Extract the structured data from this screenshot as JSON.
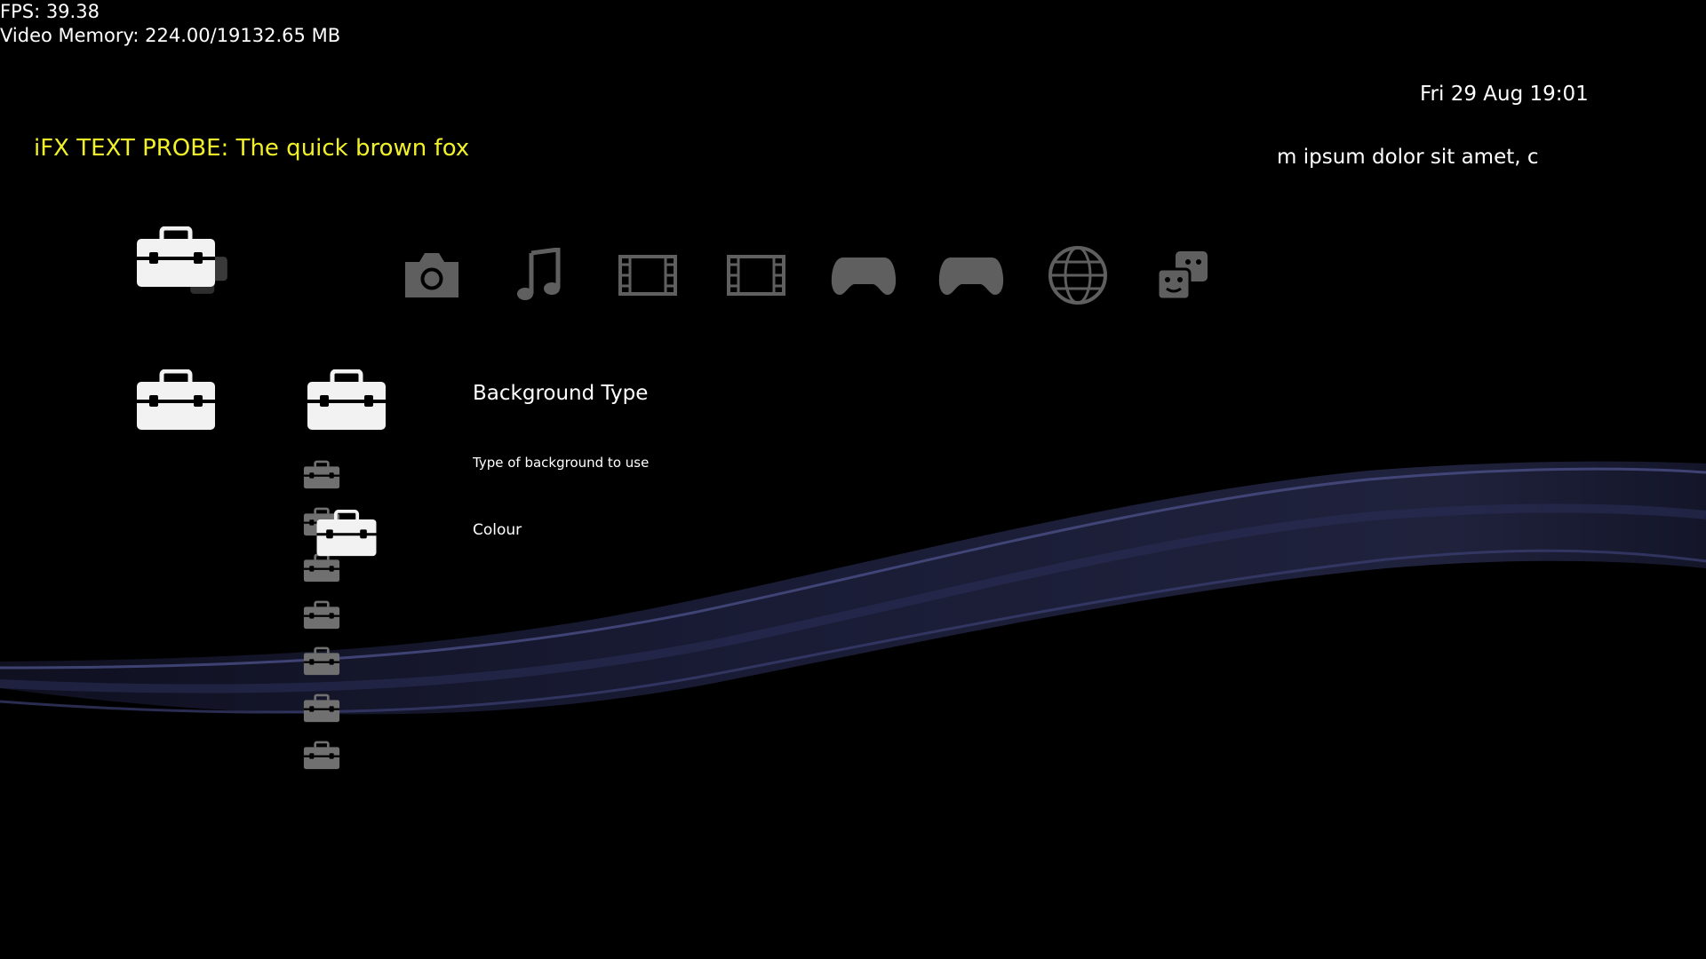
{
  "debug": {
    "fps": "FPS: 39.38",
    "video_memory": "Video Memory: 224.00/19132.65 MB"
  },
  "header": {
    "clock": "Fri 29 Aug 19:01",
    "probe_text": "iFX TEXT PROBE: The quick brown fox",
    "ticker_text": "m ipsum dolor sit amet, cc"
  },
  "categories": [
    {
      "icon": "camera-icon"
    },
    {
      "icon": "music-note-icon"
    },
    {
      "icon": "film-strip-icon"
    },
    {
      "icon": "film-strip-icon"
    },
    {
      "icon": "gamepad-icon"
    },
    {
      "icon": "gamepad-icon"
    },
    {
      "icon": "globe-icon"
    },
    {
      "icon": "friends-icon"
    }
  ],
  "selected_category": {
    "icon": "toolbox-icon"
  },
  "setting": {
    "title": "Background Type",
    "description": "Type of background to use",
    "value": "Colour"
  },
  "colors": {
    "background": "#000000",
    "probe_text": "#f1f12a",
    "inactive_icon": "#5f5f5f",
    "wave": "#3a3e6e"
  }
}
